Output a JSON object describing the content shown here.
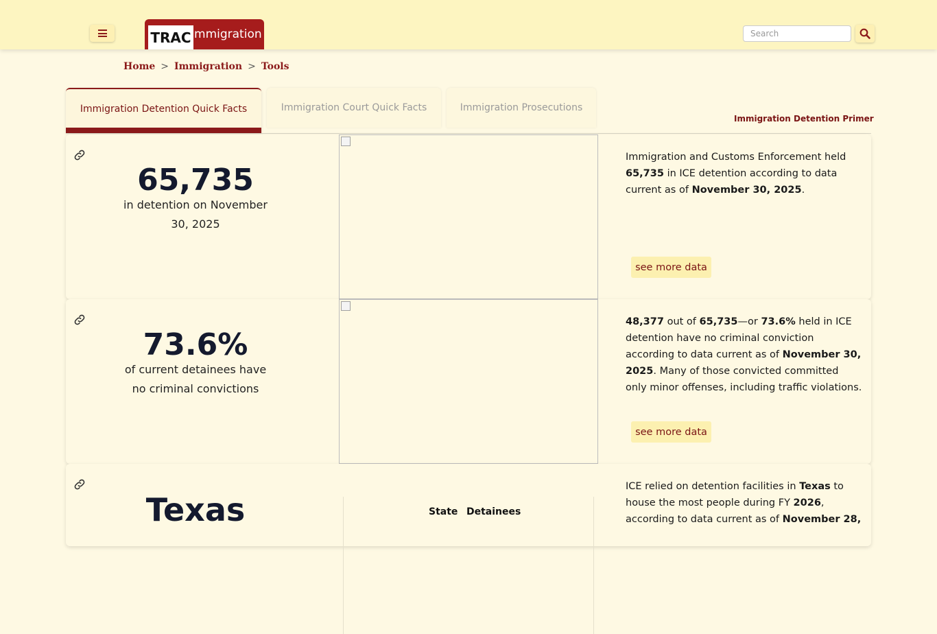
{
  "header": {
    "logo_trac": "TRAC",
    "logo_immigration": "Immigration",
    "search_placeholder": "Search"
  },
  "breadcrumb": [
    "Home",
    "Immigration",
    "Tools"
  ],
  "tabs": [
    {
      "label": "Immigration Detention Quick Facts",
      "active": true
    },
    {
      "label": "Immigration Court Quick Facts",
      "active": false
    },
    {
      "label": "Immigration Prosecutions",
      "active": false
    }
  ],
  "primer_link": "Immigration Detention Primer",
  "cards": [
    {
      "big_value": "65,735",
      "sub": "in detention on November 30, 2025",
      "desc": [
        {
          "t": "Immigration and Customs Enforcement held "
        },
        {
          "t": "65,735",
          "b": true
        },
        {
          "t": " in ICE detention according to data current as of "
        },
        {
          "t": "November 30, 2025",
          "b": true
        },
        {
          "t": "."
        }
      ],
      "button": "see more data"
    },
    {
      "big_value": "73.6%",
      "sub": "of current detainees have no criminal convictions",
      "desc": [
        {
          "t": "48,377",
          "b": true
        },
        {
          "t": " out of "
        },
        {
          "t": "65,735",
          "b": true
        },
        {
          "t": "—or "
        },
        {
          "t": "73.6%",
          "b": true
        },
        {
          "t": " held in ICE detention have no criminal conviction according to data current as of "
        },
        {
          "t": "November 30, 2025",
          "b": true
        },
        {
          "t": ". Many of those convicted committed only minor offenses, including traffic violations."
        }
      ],
      "button": "see more data"
    },
    {
      "big_value": "Texas",
      "desc": [
        {
          "t": "ICE relied on detention facilities in "
        },
        {
          "t": "Texas",
          "b": true
        },
        {
          "t": " to house the most people during FY "
        },
        {
          "t": "2026",
          "b": true
        },
        {
          "t": ", according to data current as of "
        },
        {
          "t": "November 28,",
          "b": true
        }
      ],
      "table_headers": [
        "State",
        "Detainees"
      ]
    }
  ]
}
